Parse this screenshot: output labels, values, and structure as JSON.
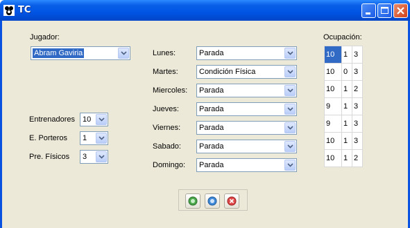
{
  "window": {
    "title": "TC"
  },
  "jugador": {
    "label": "Jugador:",
    "value": "Abram Gaviria"
  },
  "staff": [
    {
      "label": "Entrenadores",
      "value": "10"
    },
    {
      "label": "E. Porteros",
      "value": "1"
    },
    {
      "label": "Pre. Físicos",
      "value": "3"
    }
  ],
  "days": [
    {
      "label": "Lunes:",
      "value": "Parada"
    },
    {
      "label": "Martes:",
      "value": "Condición Física"
    },
    {
      "label": "Miercoles:",
      "value": "Parada"
    },
    {
      "label": "Jueves:",
      "value": "Parada"
    },
    {
      "label": "Viernes:",
      "value": "Parada"
    },
    {
      "label": "Sabado:",
      "value": "Parada"
    },
    {
      "label": "Domingo:",
      "value": "Parada"
    }
  ],
  "ocupacion": {
    "label": "Ocupación:",
    "rows": [
      [
        "10",
        "1",
        "3"
      ],
      [
        "10",
        "0",
        "3"
      ],
      [
        "10",
        "1",
        "2"
      ],
      [
        "9",
        "1",
        "3"
      ],
      [
        "9",
        "1",
        "3"
      ],
      [
        "10",
        "1",
        "3"
      ],
      [
        "10",
        "1",
        "2"
      ]
    ]
  },
  "icons": {
    "accept": "green-circle-icon",
    "info": "blue-circle-icon",
    "cancel": "red-x-circle-icon"
  },
  "colors": {
    "accent": "#316ac5",
    "titlebar": "#0054e3",
    "panel": "#ece9d8"
  }
}
